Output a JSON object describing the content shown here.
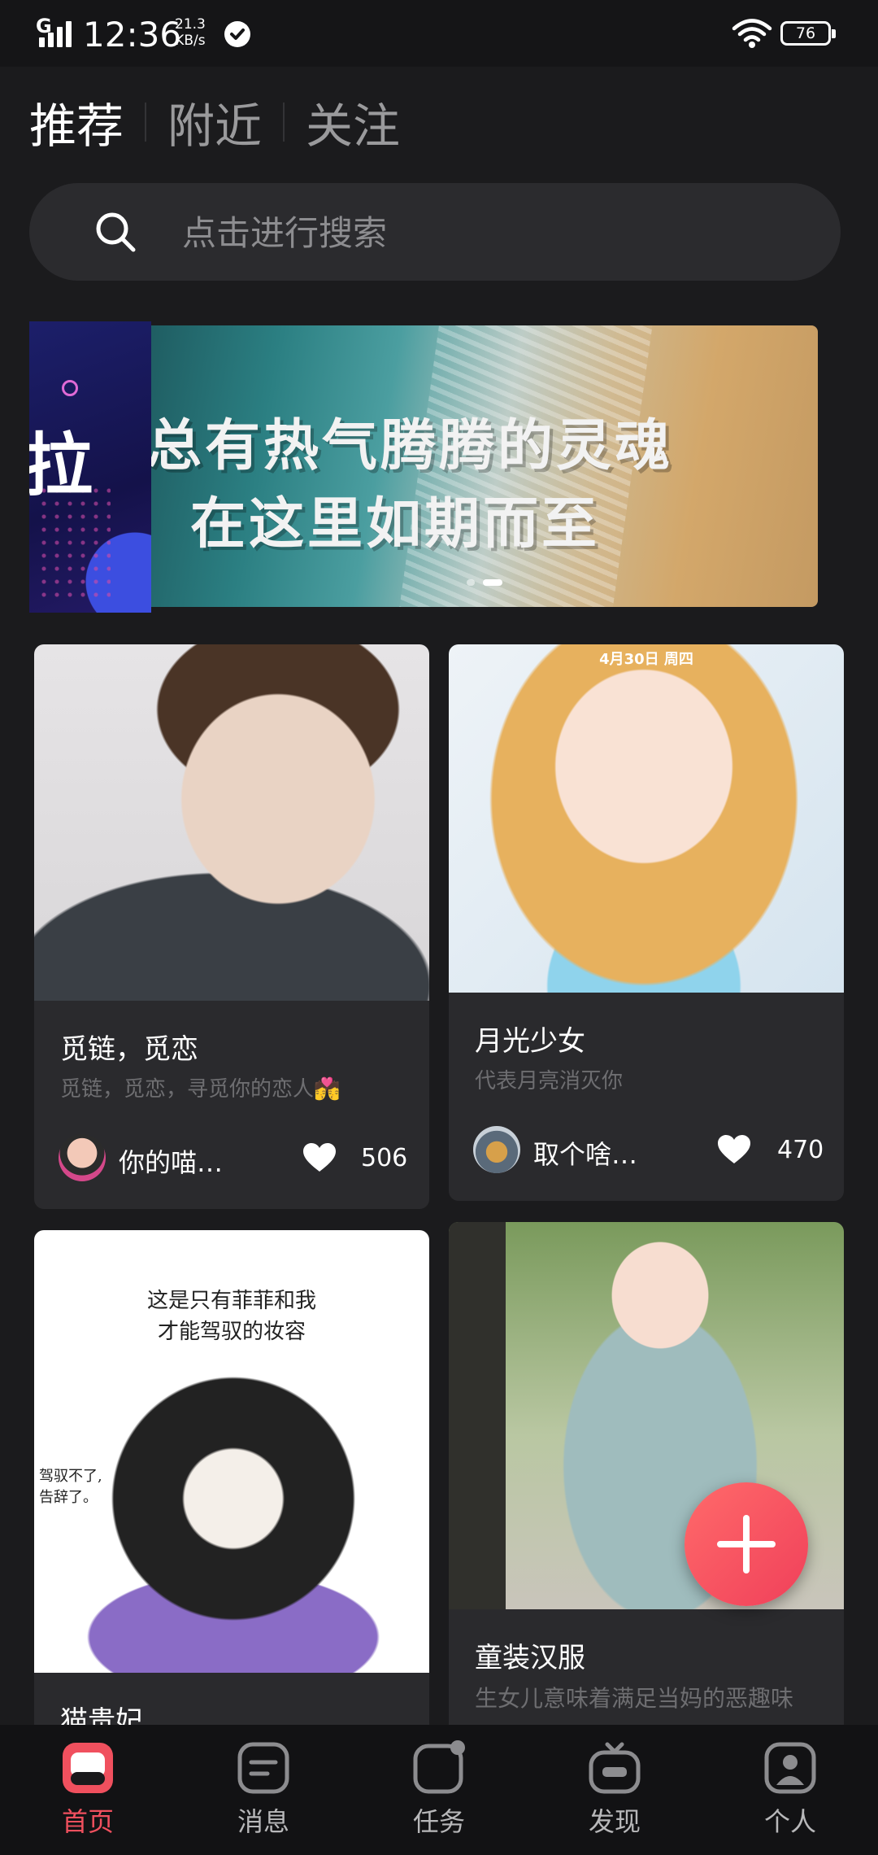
{
  "status_bar": {
    "network": "G",
    "time": "12:36",
    "speed_value": "21.3",
    "speed_unit": "KB/s",
    "battery": "76"
  },
  "tabs": [
    {
      "label": "推荐",
      "active": true
    },
    {
      "label": "附近",
      "active": false
    },
    {
      "label": "关注",
      "active": false
    }
  ],
  "search": {
    "placeholder": "点击进行搜索",
    "icon": "search-icon"
  },
  "banner": {
    "prev_text": "拉",
    "line1": "总有热气腾腾的灵魂",
    "line2": "在这里如期而至",
    "slide_count": 2,
    "active_slide": 2
  },
  "cards": [
    {
      "title": "觅链，觅恋",
      "desc": "觅链，觅恋，寻觅你的恋人💏",
      "author": "你的喵…",
      "likes": "506"
    },
    {
      "image_text": "4月30日 周四",
      "title": "月光少女",
      "desc": "代表月亮消灭你",
      "author": "取个啥…",
      "likes": "470"
    },
    {
      "image_text_1": "这是只有菲菲和我",
      "image_text_2": "才能驾驭的妆容",
      "image_text_side_1": "驾驭不了,",
      "image_text_side_2": "告辞了。",
      "title": "猫贵妃"
    },
    {
      "title": "童装汉服",
      "desc": "生女儿意味着满足当妈的恶趣味"
    }
  ],
  "fab": {
    "icon": "plus-icon"
  },
  "bottom_nav": [
    {
      "label": "首页",
      "icon": "home-icon",
      "active": true
    },
    {
      "label": "消息",
      "icon": "message-icon",
      "active": false
    },
    {
      "label": "任务",
      "icon": "task-icon",
      "active": false
    },
    {
      "label": "发现",
      "icon": "tv-icon",
      "active": false
    },
    {
      "label": "个人",
      "icon": "person-icon",
      "active": false
    }
  ],
  "colors": {
    "accent": "#f0505e",
    "background": "#1b1b1d",
    "card": "#2a2a2d"
  }
}
